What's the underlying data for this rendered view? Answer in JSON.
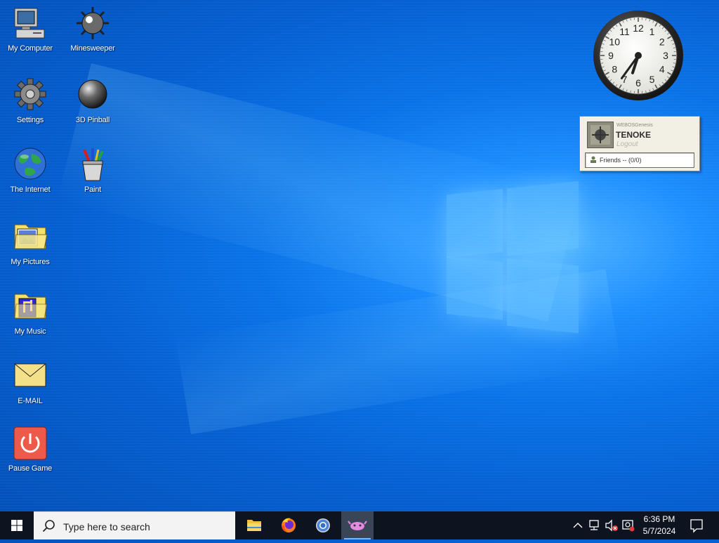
{
  "desktop": {
    "icons": [
      {
        "label": "My Computer",
        "icon": "computer-icon"
      },
      {
        "label": "Minesweeper",
        "icon": "mine-icon"
      },
      {
        "label": "Settings",
        "icon": "gear-icon"
      },
      {
        "label": "3D Pinball",
        "icon": "pinball-icon"
      },
      {
        "label": "The Internet",
        "icon": "globe-icon"
      },
      {
        "label": "Paint",
        "icon": "paint-icon"
      },
      {
        "label": "My Pictures",
        "icon": "pictures-folder-icon"
      },
      {
        "label": "My Music",
        "icon": "music-folder-icon"
      },
      {
        "label": "E-MAIL",
        "icon": "envelope-icon"
      },
      {
        "label": "Pause Game",
        "icon": "power-icon"
      }
    ]
  },
  "clock_widget": {
    "numerals": [
      "12",
      "1",
      "2",
      "3",
      "4",
      "5",
      "6",
      "7",
      "8",
      "9",
      "10",
      "11"
    ],
    "hour": 6,
    "minute": 36
  },
  "login_widget": {
    "site": "WEBOSGenesis",
    "username": "TENOKE",
    "logout_label": "Logout",
    "friends_label": "Friends -- (0/0)"
  },
  "taskbar": {
    "search_placeholder": "Type here to search",
    "apps": [
      {
        "name": "File Explorer",
        "icon": "folder-icon"
      },
      {
        "name": "Firefox",
        "icon": "firefox-icon"
      },
      {
        "name": "Chrome",
        "icon": "chrome-icon"
      },
      {
        "name": "Game",
        "icon": "game-icon",
        "active": true
      }
    ],
    "time": "6:36 PM",
    "date": "5/7/2024"
  },
  "colors": {
    "taskbar": "#0d1420",
    "desktop_blue": "#0a73e8",
    "accent": "#79b8ff"
  }
}
